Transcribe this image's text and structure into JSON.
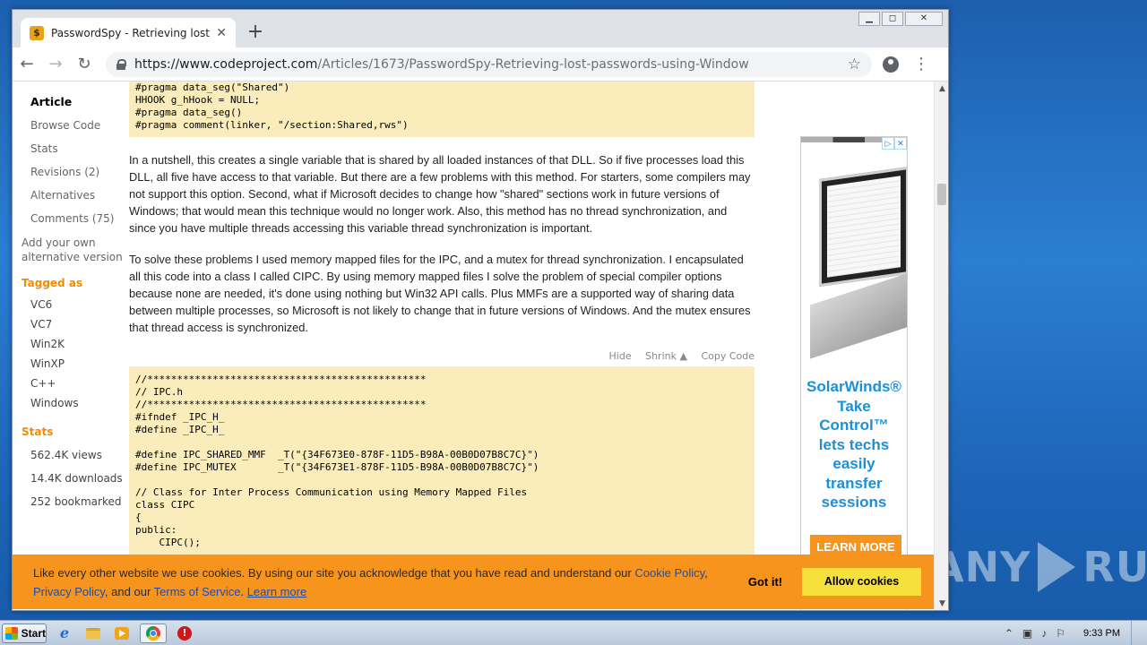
{
  "browser": {
    "tab_title": "PasswordSpy - Retrieving lost passw",
    "tab_favicon": "$",
    "new_tab": "+",
    "url_host": "https://www.codeproject.com",
    "url_path": "/Articles/1673/PasswordSpy-Retrieving-lost-passwords-using-Window",
    "win_min": "▁",
    "win_max": "◻",
    "win_close": "✕"
  },
  "sidenav": {
    "items": [
      {
        "label": "Article"
      },
      {
        "label": "Browse Code"
      },
      {
        "label": "Stats"
      },
      {
        "label": "Revisions (2)"
      },
      {
        "label": "Alternatives"
      },
      {
        "label": "Comments (75)"
      }
    ],
    "add_alternative": "Add your own alternative version",
    "tagged_heading": "Tagged as",
    "tags": [
      "VC6",
      "VC7",
      "Win2K",
      "WinXP",
      "C++",
      "Windows"
    ],
    "stats_heading": "Stats",
    "stats": [
      "562.4K views",
      "14.4K downloads",
      "252 bookmarked"
    ]
  },
  "article": {
    "code1": "#pragma data_seg(\"Shared\")\nHHOOK g_hHook = NULL;\n#pragma data_seg()\n#pragma comment(linker, \"/section:Shared,rws\")",
    "para1": "In a nutshell, this creates a single variable that is shared by all loaded instances of that DLL. So if five processes load this DLL, all five have access to that variable. But there are a few problems with this method. For starters, some compilers may not support this option. Second, what if Microsoft decides to change how \"shared\" sections work in future versions of Windows; that would mean this technique would no longer work. Also, this method has no thread synchronization, and since you have multiple threads accessing this variable thread synchronization is important.",
    "para2": "To solve these problems I used memory mapped files for the IPC, and a mutex for thread synchronization. I encapsulated all this code into a class I called CIPC. By using memory mapped files I solve the problem of special compiler options because none are needed, it's done using nothing but Win32 API calls. Plus MMFs are a supported way of sharing data between multiple processes, so Microsoft is not likely to change that in future versions of Windows. And the mutex ensures that thread access is synchronized.",
    "code_hide": "Hide",
    "code_shrink": "Shrink ▲",
    "code_copy": "Copy Code",
    "code2": "//***********************************************\n// IPC.h\n//***********************************************\n#ifndef _IPC_H_\n#define _IPC_H_\n\n#define IPC_SHARED_MMF  _T(\"{34F673E0-878F-11D5-B98A-00B0D07B8C7C}\")\n#define IPC_MUTEX       _T(\"{34F673E1-878F-11D5-B98A-00B0D07B8C7C}\")\n\n// Class for Inter Process Communication using Memory Mapped Files\nclass CIPC\n{\npublic:\n    CIPC();"
  },
  "ad": {
    "brand_line1": "SolarWinds®",
    "brand_line2": "Take",
    "brand_line3": "Control™",
    "brand_line4": "lets techs",
    "brand_line5": "easily",
    "brand_line6": "transfer",
    "brand_line7": "sessions",
    "cta": "LEARN MORE",
    "adchoice_i": "▷",
    "adchoice_x": "✕"
  },
  "cookie": {
    "text_before": "Like every other website we use cookies. By using our site you acknowledge that you have read and understand our ",
    "link_policy": "Cookie Policy",
    "sep": ", ",
    "link_privacy": "Privacy Policy",
    "and": ", and our ",
    "link_terms": "Terms of Service",
    "dot": ". ",
    "link_learn": "Learn more",
    "got_it": "Got it!",
    "allow": "Allow cookies"
  },
  "taskbar": {
    "start": "Start",
    "clock": "9:33 PM"
  },
  "watermark": "ANY ▷ RUN",
  "colors": {
    "accent_orange": "#f7941d",
    "code_bg": "#fbedbb",
    "link_blue": "#1d4ea6",
    "brand_blue": "#1c8fd6"
  }
}
